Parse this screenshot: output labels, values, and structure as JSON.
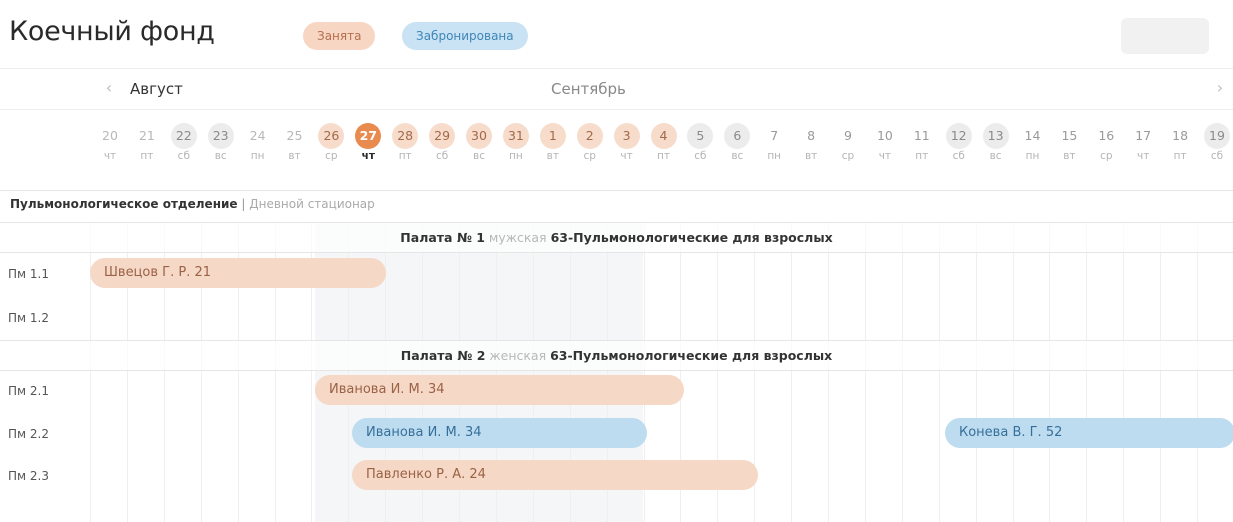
{
  "header": {
    "title": "Коечный фонд",
    "legend_busy": "Занята",
    "legend_reserved": "Забронирована"
  },
  "colors": {
    "busy": "#f6d8c6",
    "reserved": "#bedcf0",
    "today": "#e98a4f",
    "weekend": "#ececec"
  },
  "months": {
    "prev_icon": "chevron-left-icon",
    "next_icon": "chevron-right-icon",
    "first": "Август",
    "second": "Сентябрь"
  },
  "days": [
    {
      "num": "20",
      "wd": "чт",
      "state": "past"
    },
    {
      "num": "21",
      "wd": "пт",
      "state": "past"
    },
    {
      "num": "22",
      "wd": "сб",
      "state": "weekend"
    },
    {
      "num": "23",
      "wd": "вс",
      "state": "weekend"
    },
    {
      "num": "24",
      "wd": "пн",
      "state": "past"
    },
    {
      "num": "25",
      "wd": "вт",
      "state": "past"
    },
    {
      "num": "26",
      "wd": "ср",
      "state": "busy"
    },
    {
      "num": "27",
      "wd": "чт",
      "state": "today"
    },
    {
      "num": "28",
      "wd": "пт",
      "state": "busy"
    },
    {
      "num": "29",
      "wd": "сб",
      "state": "busy"
    },
    {
      "num": "30",
      "wd": "вс",
      "state": "busy"
    },
    {
      "num": "31",
      "wd": "пн",
      "state": "busy"
    },
    {
      "num": "1",
      "wd": "вт",
      "state": "busy"
    },
    {
      "num": "2",
      "wd": "ср",
      "state": "busy"
    },
    {
      "num": "3",
      "wd": "чт",
      "state": "busy"
    },
    {
      "num": "4",
      "wd": "пт",
      "state": "busy"
    },
    {
      "num": "5",
      "wd": "сб",
      "state": "weekend"
    },
    {
      "num": "6",
      "wd": "вс",
      "state": "weekend"
    },
    {
      "num": "7",
      "wd": "пн",
      "state": ""
    },
    {
      "num": "8",
      "wd": "вт",
      "state": ""
    },
    {
      "num": "9",
      "wd": "ср",
      "state": ""
    },
    {
      "num": "10",
      "wd": "чт",
      "state": ""
    },
    {
      "num": "11",
      "wd": "пт",
      "state": ""
    },
    {
      "num": "12",
      "wd": "сб",
      "state": "weekend"
    },
    {
      "num": "13",
      "wd": "вс",
      "state": "weekend"
    },
    {
      "num": "14",
      "wd": "пн",
      "state": ""
    },
    {
      "num": "15",
      "wd": "вт",
      "state": ""
    },
    {
      "num": "16",
      "wd": "ср",
      "state": ""
    },
    {
      "num": "17",
      "wd": "чт",
      "state": ""
    },
    {
      "num": "18",
      "wd": "пт",
      "state": ""
    },
    {
      "num": "19",
      "wd": "сб",
      "state": "weekend"
    }
  ],
  "department": {
    "name": "Пульмонологическое отделение",
    "separator": "|",
    "sub": "Дневной стационар"
  },
  "wards": [
    {
      "prefix": "Палата № 1",
      "gender": "мужская",
      "profile": "63-Пульмонологические для взрослых",
      "beds": [
        "Пм 1.1",
        "Пм 1.2"
      ]
    },
    {
      "prefix": "Палата № 2",
      "gender": "женская",
      "profile": "63-Пульмонологические для взрослых",
      "beds": [
        "Пм 2.1",
        "Пм 2.2",
        "Пм 2.3"
      ]
    }
  ],
  "bookings": [
    {
      "bed": "Пм 1.1",
      "label": "Швецов Г. Р. 21",
      "status": "busy"
    },
    {
      "bed": "Пм 2.1",
      "label": "Иванова И. М. 34",
      "status": "busy"
    },
    {
      "bed": "Пм 2.2",
      "label": "Иванова И. М. 34",
      "status": "reserved"
    },
    {
      "bed": "Пм 2.2",
      "label": "Конева В. Г. 52",
      "status": "reserved"
    },
    {
      "bed": "Пм 2.3",
      "label": "Павленко Р. А. 24",
      "status": "busy"
    }
  ]
}
